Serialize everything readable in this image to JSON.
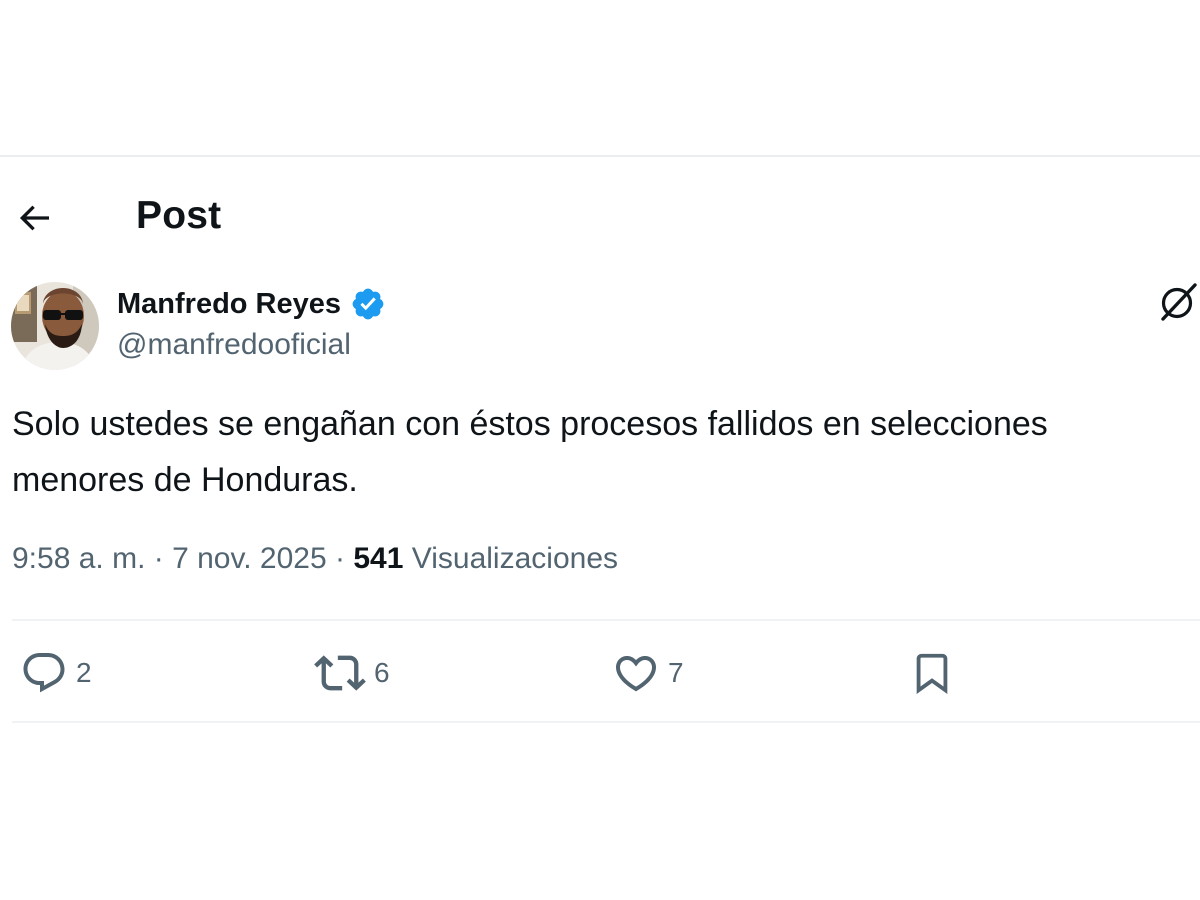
{
  "header": {
    "title": "Post"
  },
  "post": {
    "author": {
      "display_name": "Manfredo Reyes",
      "handle": "@manfredooficial",
      "verified": true
    },
    "text_lines": [
      "Solo ustedes se engañan con éstos procesos fallidos en selecciones",
      "menores de Honduras."
    ],
    "meta": {
      "time": "9:58 a. m.",
      "separator": "·",
      "date": "7 nov. 2025",
      "views_count": "541",
      "views_label": "Visualizaciones"
    },
    "actions": {
      "replies": "2",
      "reposts": "6",
      "likes": "7"
    }
  },
  "icons": {
    "back": "arrow-left-icon",
    "verified": "verified-badge-icon",
    "grok": "grok-icon",
    "reply": "reply-icon",
    "repost": "repost-icon",
    "like": "heart-icon",
    "bookmark": "bookmark-icon"
  },
  "colors": {
    "text_primary": "#0f1419",
    "text_secondary": "#536471",
    "verified_blue": "#1d9bf0",
    "divider": "#eff3f4"
  }
}
